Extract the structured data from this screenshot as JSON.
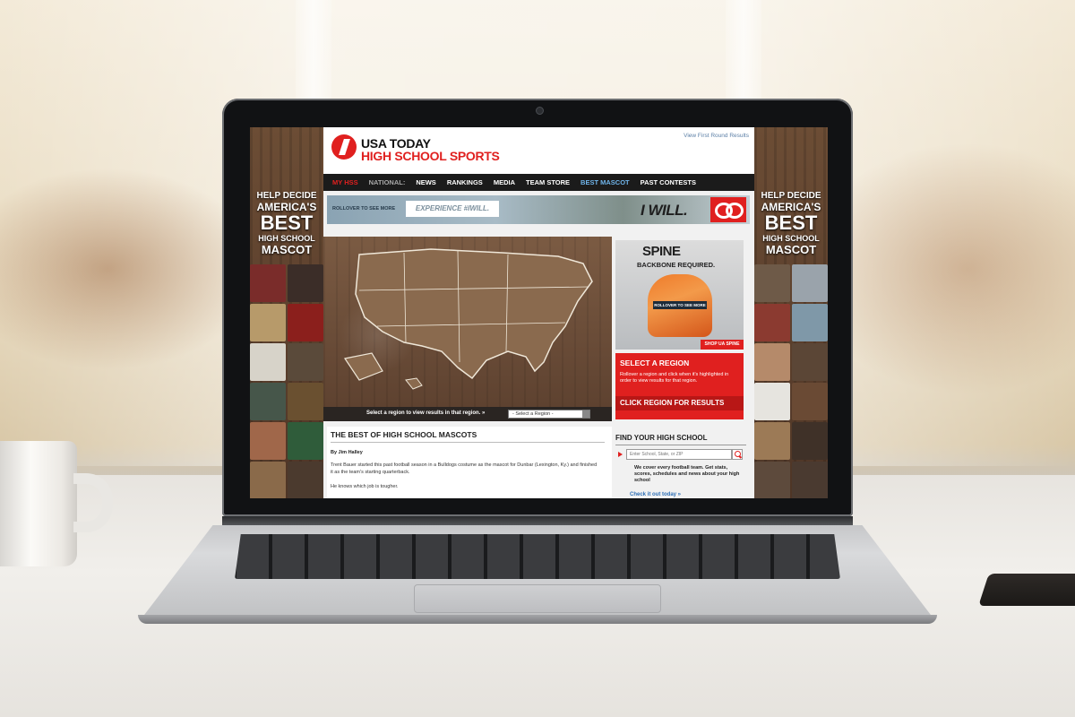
{
  "site": {
    "logo_line1": "USA TODAY",
    "logo_line2": "HIGH SCHOOL SPORTS",
    "header_link": "View First Round Results"
  },
  "nav": {
    "items": [
      {
        "label": "MY HSS",
        "style": "red"
      },
      {
        "label": "NATIONAL:",
        "style": "muted"
      },
      {
        "label": "NEWS",
        "style": "normal"
      },
      {
        "label": "RANKINGS",
        "style": "normal"
      },
      {
        "label": "MEDIA",
        "style": "normal"
      },
      {
        "label": "TEAM STORE",
        "style": "normal"
      },
      {
        "label": "BEST MASCOT",
        "style": "active"
      },
      {
        "label": "PAST CONTESTS",
        "style": "normal"
      }
    ]
  },
  "banner": {
    "small_text": "ROLLOVER TO SEE MORE",
    "box_text": "EXPERIENCE #IWILL.",
    "headline": "I WILL."
  },
  "rail": {
    "line1": "HELP DECIDE",
    "line2": "AMERICA'S",
    "line3": "BEST",
    "line4": "HIGH SCHOOL",
    "line5": "MASCOT"
  },
  "map": {
    "region_prompt": "Select a region to view results in that region. »",
    "region_select_value": "- Select a Region -"
  },
  "ad_spine": {
    "logo": "SPINE",
    "tagline": "BACKBONE REQUIRED.",
    "rollover": "ROLLOVER TO SEE MORE",
    "shop": "SHOP UA SPINE"
  },
  "select_region": {
    "title": "SELECT A REGION",
    "description": "Rollover a region and click when it's highlighted in order to view results for that region.",
    "cta": "CLICK REGION FOR RESULTS"
  },
  "article": {
    "title": "THE BEST OF HIGH SCHOOL MASCOTS",
    "byline": "By Jim Halley",
    "paragraph1": "Trent Bauer started this past football season in a Bulldogs costume as the mascot for Dunbar (Lexington, Ky.) and finished it as the team's starting quarterback.",
    "paragraph2": "He knows which job is tougher."
  },
  "find_school": {
    "title": "FIND YOUR HIGH SCHOOL",
    "placeholder": "Enter School, State, or ZIP",
    "description": "We cover every football team. Get stats, scores, schedules and news about your high school",
    "link": "Check it out today »"
  },
  "colors": {
    "brand_red": "#e0201f",
    "nav_bg": "#1b1b1b",
    "nav_active": "#6fb4ea",
    "link_blue": "#2d6fb6"
  }
}
